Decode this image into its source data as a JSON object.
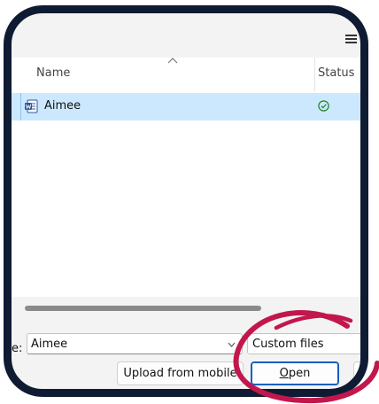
{
  "list": {
    "columns": {
      "name": "Name",
      "status": "Status"
    },
    "files": [
      {
        "name": "Aimee",
        "icon": "word-document-icon",
        "status_icon": "synced-check-icon"
      }
    ]
  },
  "footer": {
    "file_name_label": "e:",
    "file_name_value": "Aimee",
    "file_type_value": "Custom files",
    "upload_label": "Upload from mobile",
    "open_label_mnemonic": "O",
    "open_label_rest": "pen"
  },
  "colors": {
    "frame": "#0f1b33",
    "selection": "#cce8ff",
    "accent": "#0a5fbf",
    "annotation": "#c2174c",
    "word_blue": "#2b579a",
    "status_green": "#107c10"
  }
}
